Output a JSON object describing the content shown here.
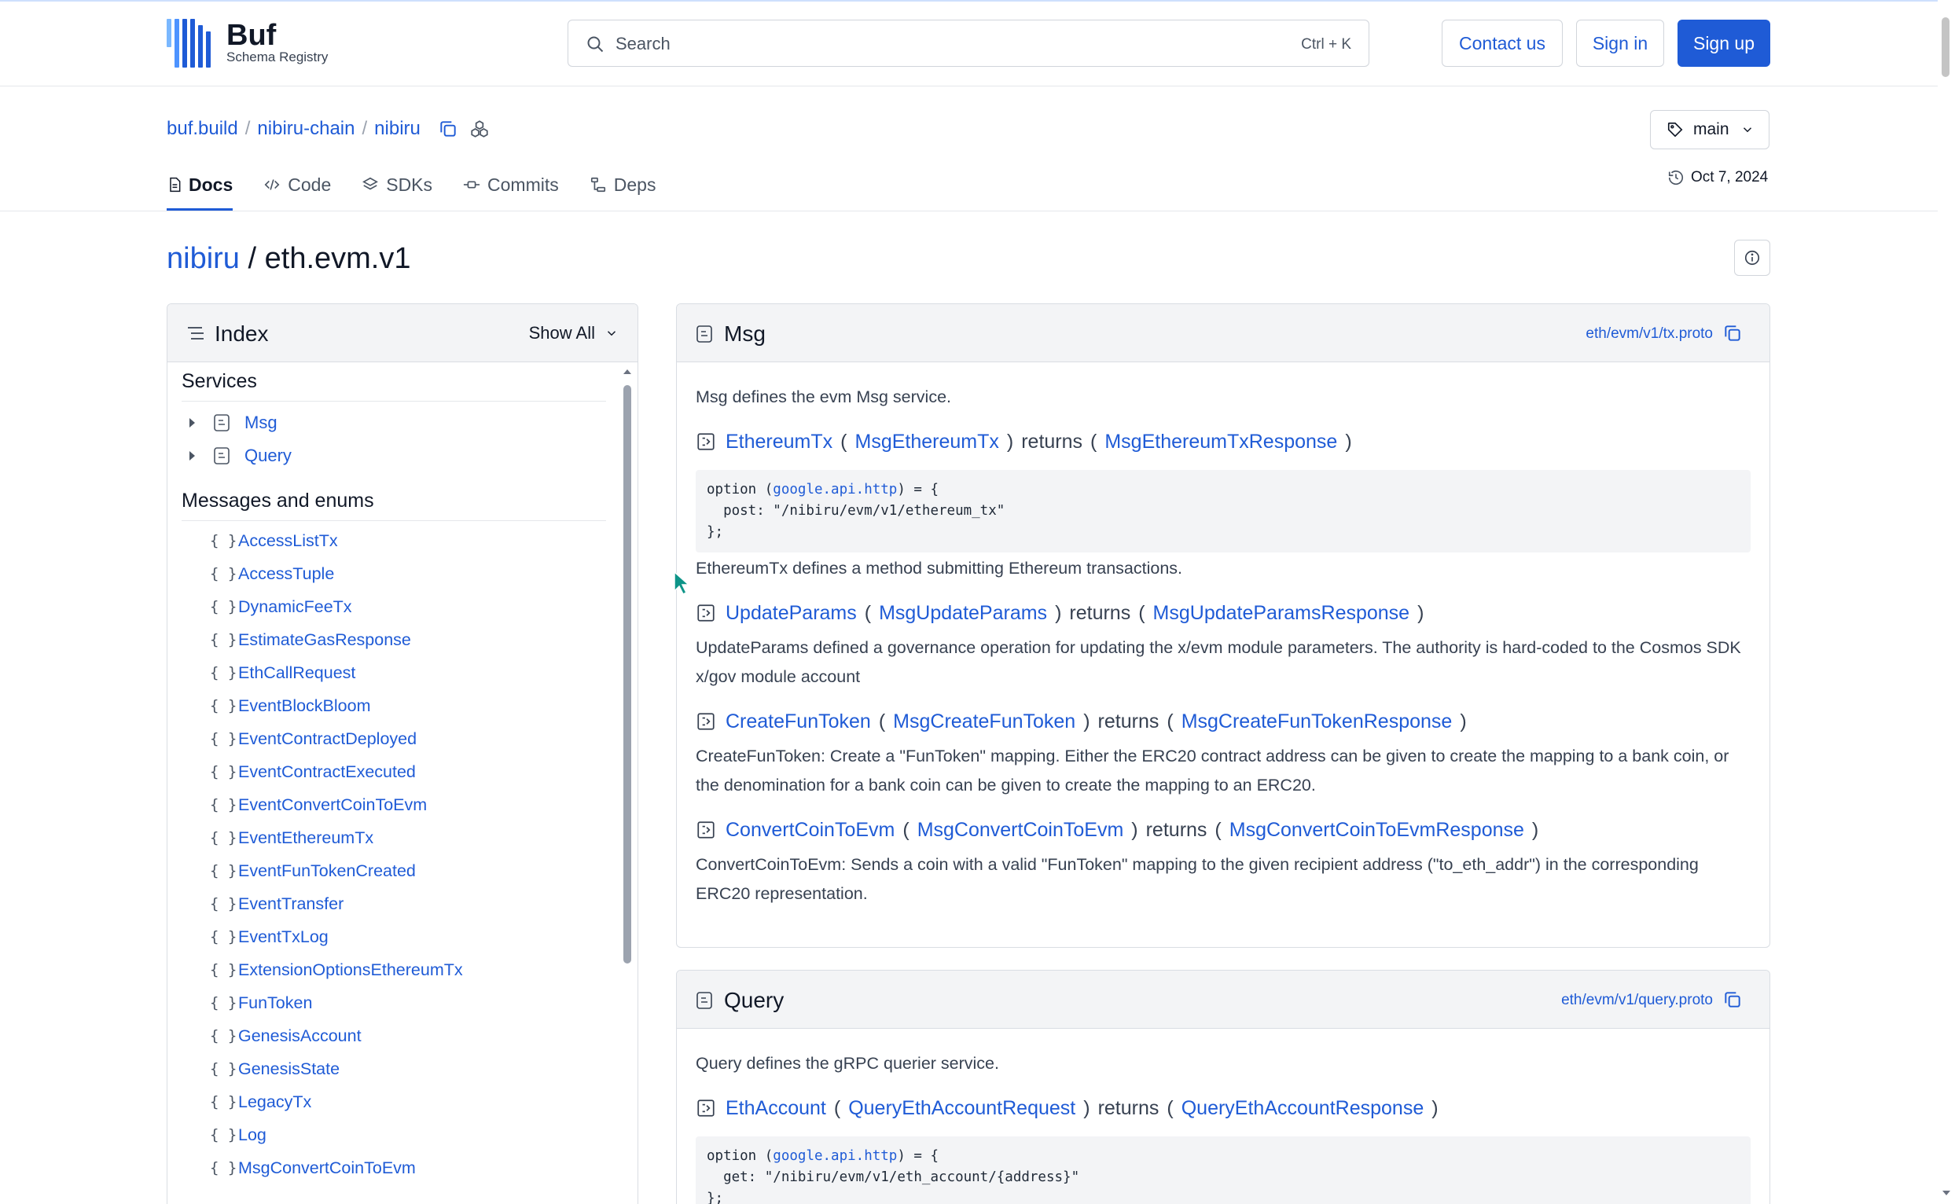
{
  "header": {
    "brand": "Buf",
    "subtitle": "Schema Registry",
    "search_placeholder": "Search",
    "search_shortcut": "Ctrl + K",
    "contact_label": "Contact us",
    "signin_label": "Sign in",
    "signup_label": "Sign up"
  },
  "repo": {
    "crumbs": [
      "buf.build",
      "nibiru-chain",
      "nibiru"
    ],
    "separator": "/",
    "branch": "main",
    "updated": "Oct 7, 2024",
    "tabs": [
      "Docs",
      "Code",
      "SDKs",
      "Commits",
      "Deps"
    ]
  },
  "page": {
    "title_link": "nibiru",
    "title_sep": " / ",
    "title_rest": "eth.evm.v1"
  },
  "index": {
    "title": "Index",
    "show_all": "Show All",
    "services_heading": "Services",
    "services": [
      "Msg",
      "Query"
    ],
    "messages_heading": "Messages and enums",
    "brace": "{ }",
    "messages": [
      "AccessListTx",
      "AccessTuple",
      "DynamicFeeTx",
      "EstimateGasResponse",
      "EthCallRequest",
      "EventBlockBloom",
      "EventContractDeployed",
      "EventContractExecuted",
      "EventConvertCoinToEvm",
      "EventEthereumTx",
      "EventFunTokenCreated",
      "EventTransfer",
      "EventTxLog",
      "ExtensionOptionsEthereumTx",
      "FunToken",
      "GenesisAccount",
      "GenesisState",
      "LegacyTx",
      "Log",
      "MsgConvertCoinToEvm"
    ]
  },
  "msg_card": {
    "title": "Msg",
    "file": "eth/evm/v1/tx.proto",
    "description": "Msg defines the evm Msg service.",
    "returns": "returns",
    "rpcs": [
      {
        "name": "EthereumTx",
        "req": "MsgEthereumTx",
        "resp": "MsgEthereumTxResponse",
        "code1a": "option (",
        "code1b": "google.api.http",
        "code1c": ") = {",
        "code2": "  post: \"/nibiru/evm/v1/ethereum_tx\"",
        "code3": "};",
        "desc": "EthereumTx defines a method submitting Ethereum transactions."
      },
      {
        "name": "UpdateParams",
        "req": "MsgUpdateParams",
        "resp": "MsgUpdateParamsResponse",
        "desc": "UpdateParams defined a governance operation for updating the x/evm module parameters. The authority is hard-coded to the Cosmos SDK x/gov module account"
      },
      {
        "name": "CreateFunToken",
        "req": "MsgCreateFunToken",
        "resp": "MsgCreateFunTokenResponse",
        "desc": "CreateFunToken: Create a \"FunToken\" mapping. Either the ERC20 contract address can be given to create the mapping to a bank coin, or the denomination for a bank coin can be given to create the mapping to an ERC20."
      },
      {
        "name": "ConvertCoinToEvm",
        "req": "MsgConvertCoinToEvm",
        "resp": "MsgConvertCoinToEvmResponse",
        "desc": "ConvertCoinToEvm: Sends a coin with a valid \"FunToken\" mapping to the given recipient address (\"to_eth_addr\") in the corresponding ERC20 representation."
      }
    ]
  },
  "query_card": {
    "title": "Query",
    "file": "eth/evm/v1/query.proto",
    "description": "Query defines the gRPC querier service.",
    "rpc": {
      "name": "EthAccount",
      "req": "QueryEthAccountRequest",
      "resp": "QueryEthAccountResponse",
      "code1a": "option (",
      "code1b": "google.api.http",
      "code1c": ") = {",
      "code2": "  get: \"/nibiru/evm/v1/eth_account/{address}\"",
      "code3": "};"
    }
  },
  "colors": {
    "accent": "#1f5bd6",
    "panel": "#f3f4f6",
    "border": "#d9dde3"
  }
}
